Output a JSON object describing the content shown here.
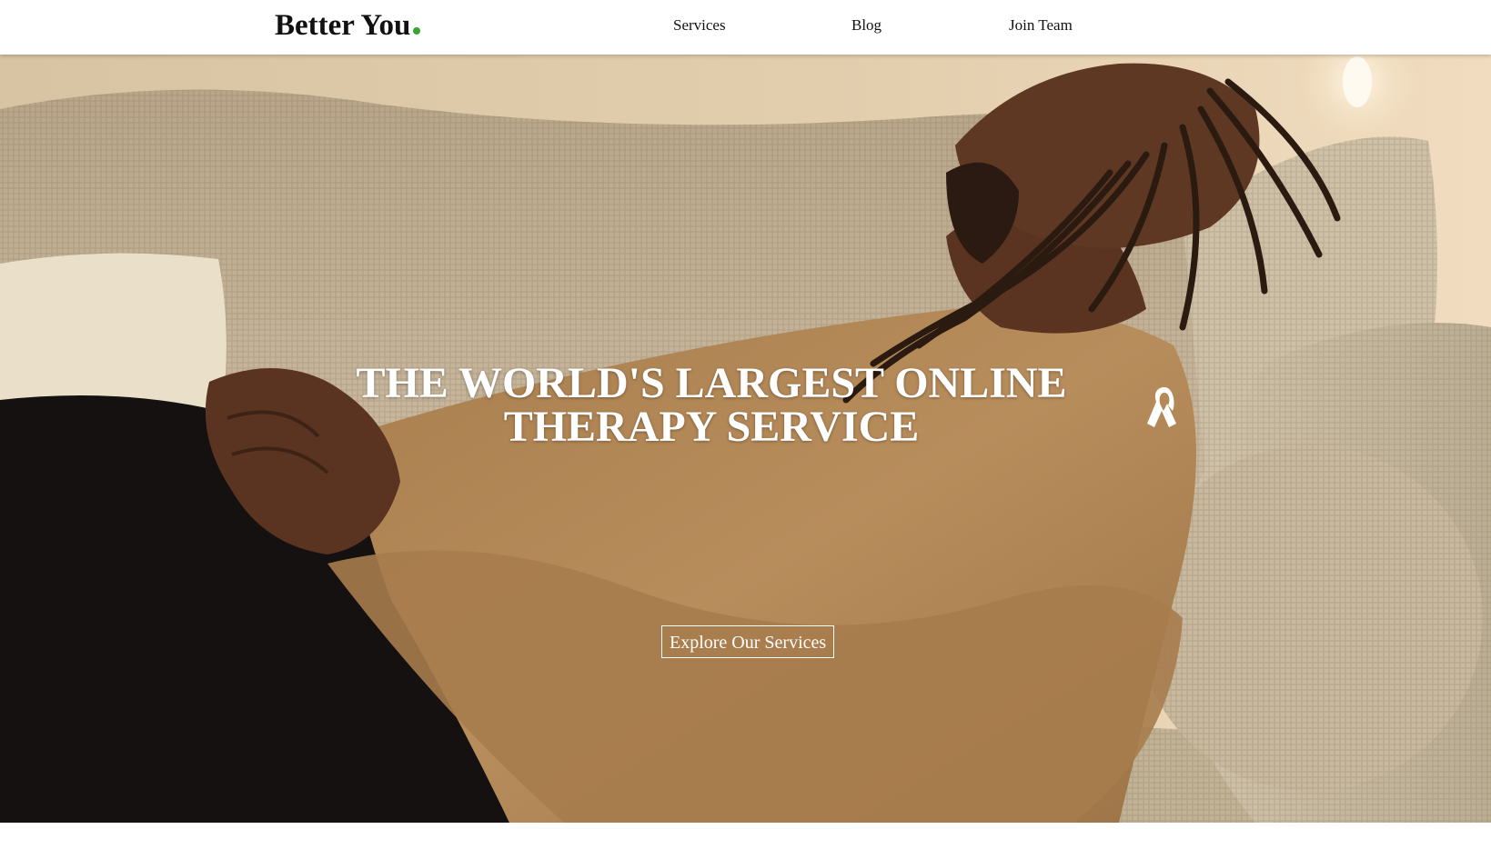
{
  "header": {
    "logo_text": "Better You",
    "logo_dot_color": "#3aa335",
    "nav": [
      {
        "label": "Services"
      },
      {
        "label": "Blog"
      },
      {
        "label": "Join Team"
      }
    ]
  },
  "hero": {
    "background": "photo-man-resting-on-couch",
    "headline_line1": "THE WORLD'S LARGEST ONLINE",
    "headline_line2": "THERAPY SERVICE",
    "cta_label": "Explore Our Services",
    "badge_icon": "awareness-ribbon-icon"
  },
  "colors": {
    "header_bg": "#ffffff",
    "text_dark": "#111111",
    "hero_text": "#ffffff",
    "sofa": "#c9b89f",
    "sweater": "#b08656",
    "skin": "#5a3420"
  }
}
